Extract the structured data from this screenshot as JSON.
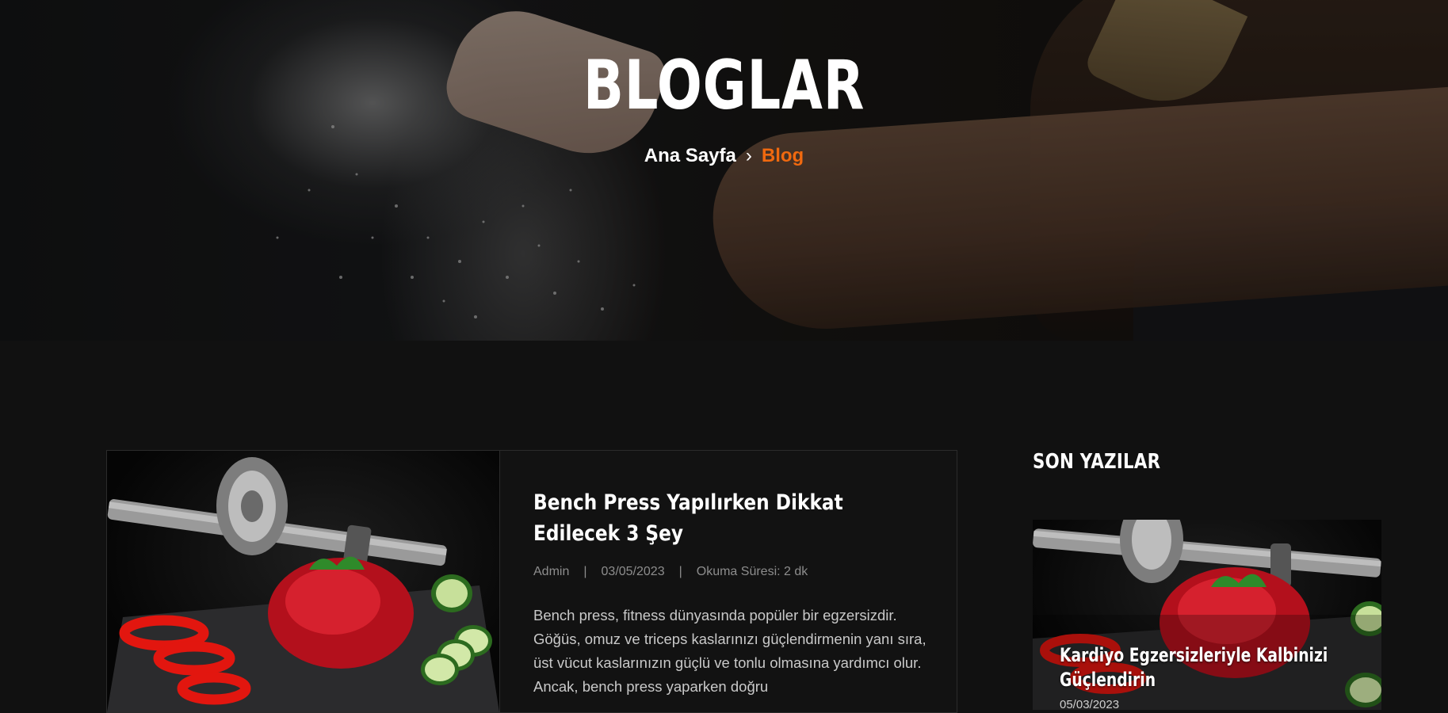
{
  "hero": {
    "title": "BLOGLAR",
    "breadcrumb": {
      "home": "Ana Sayfa",
      "separator": "›",
      "current": "Blog"
    }
  },
  "post": {
    "title": "Bench Press Yapılırken Dikkat Edilecek 3 Şey",
    "author": "Admin",
    "date": "03/05/2023",
    "reading_time": "Okuma Süresi: 2 dk",
    "meta_separator": "|",
    "excerpt": "Bench press, fitness dünyasında popüler bir egzersizdir. Göğüs, omuz ve triceps kaslarınızı güçlendirmenin yanı sıra, üst vücut kaslarınızın güçlü ve tonlu olmasına yardımcı olur. Ancak, bench press yaparken doğru"
  },
  "sidebar": {
    "title": "SON YAZILAR",
    "recent": [
      {
        "title": "Kardiyo Egzersizleriyle Kalbinizi Güçlendirin",
        "date": "05/03/2023"
      }
    ]
  },
  "colors": {
    "accent": "#f0690f",
    "background": "#111111",
    "meta_text": "#8d8d8d"
  }
}
